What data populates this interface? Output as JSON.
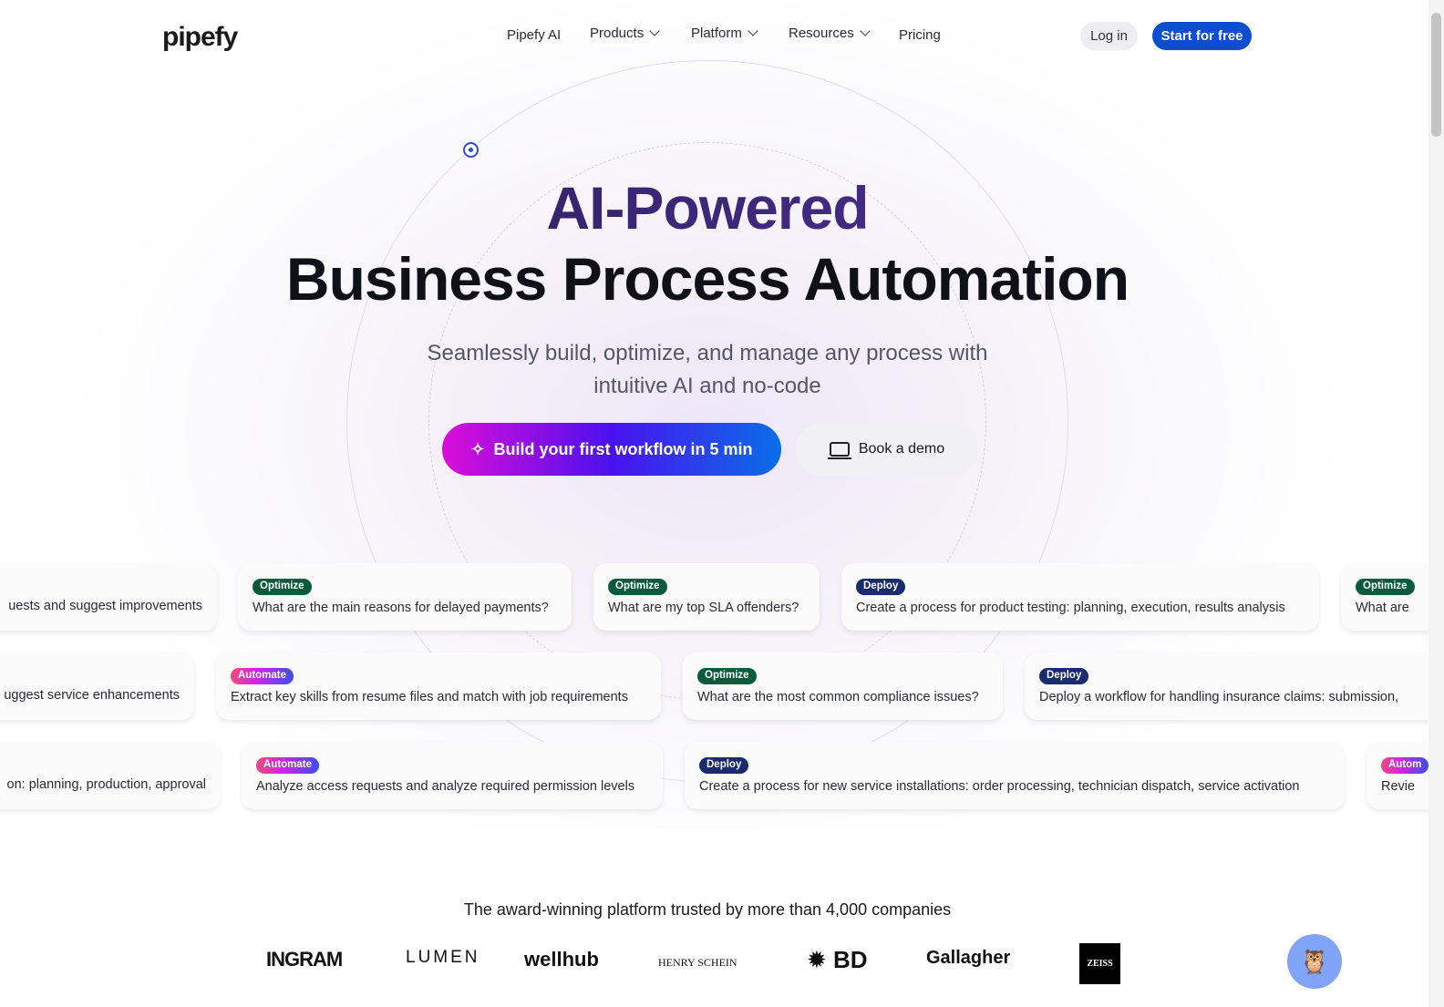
{
  "header": {
    "logo": "pipefy",
    "nav": [
      "Pipefy AI",
      "Products",
      "Platform",
      "Resources",
      "Pricing"
    ],
    "login": "Log in",
    "start": "Start for free"
  },
  "hero": {
    "title_line1": "AI-Powered",
    "title_line2": "Business Process Automation",
    "subtitle_line1": "Seamlessly build, optimize, and manage any process with",
    "subtitle_line2": "intuitive AI and no-code",
    "cta": "Build your first workflow in 5 min",
    "demo": "Book a demo"
  },
  "cards": [
    [
      {
        "tag": "",
        "text": "uests and suggest improvements"
      },
      {
        "tag": "Optimize",
        "text": "What are the main reasons for delayed payments?"
      },
      {
        "tag": "Optimize",
        "text": "What are my top SLA offenders?"
      },
      {
        "tag": "Deploy",
        "text": "Create a process for product testing: planning, execution, results analysis"
      },
      {
        "tag": "Optimize",
        "text": "What are"
      }
    ],
    [
      {
        "tag": "",
        "text": "uggest service enhancements"
      },
      {
        "tag": "Automate",
        "text": "Extract key skills from resume files and match with job requirements"
      },
      {
        "tag": "Optimize",
        "text": "What are the most common compliance issues?"
      },
      {
        "tag": "Deploy",
        "text": "Deploy a workflow for handling insurance claims: submission,"
      }
    ],
    [
      {
        "tag": "",
        "text": "on: planning, production, approval"
      },
      {
        "tag": "Automate",
        "text": "Analyze access requests and analyze required permission levels"
      },
      {
        "tag": "Deploy",
        "text": "Create a process for new service installations: order processing, technician dispatch, service activation"
      },
      {
        "tag": "Autom",
        "text": "Revie"
      }
    ]
  ],
  "trust": {
    "text": "The award-winning platform trusted by more than 4,000 companies",
    "brands": [
      "INGRAM",
      "LUMEN",
      "wellhub",
      "HENRY SCHEIN",
      "BD",
      "Gallagher",
      "ZEISS"
    ]
  },
  "colors": {
    "primary": "#0b4fd0",
    "optimize": "#0b5a3c",
    "deploy": "#1a2b6e"
  }
}
